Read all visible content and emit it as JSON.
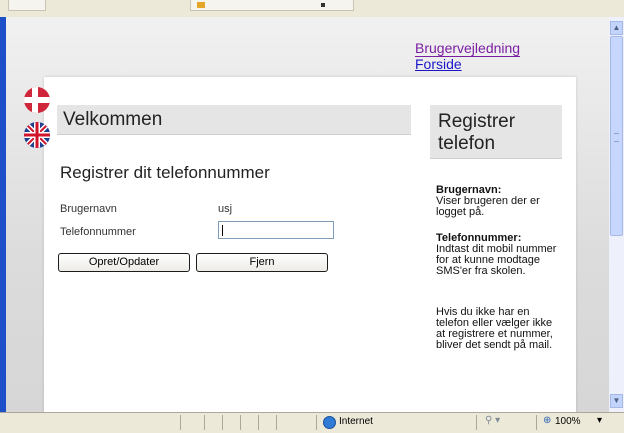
{
  "nav": {
    "user_guide": "Brugervejledning",
    "home": "Forside"
  },
  "languages": [
    "Dansk",
    "English"
  ],
  "main": {
    "title": "Velkommen",
    "subtitle": "Registrer dit telefonnummer",
    "username_label": "Brugernavn",
    "username_value": "usj",
    "phone_label": "Telefonnummer",
    "phone_value": "",
    "save_button": "Opret/Opdater",
    "remove_button": "Fjern"
  },
  "sidebar": {
    "title_line1": "Registrer",
    "title_line2": "telefon",
    "help_username_title": "Brugernavn:",
    "help_username_text": "Viser brugeren der er logget på.",
    "help_phone_title": "Telefonnummer:",
    "help_phone_text": "Indtast dit mobil nummer for at kunne modtage SMS'er fra skolen.",
    "help_note": "Hvis du ikke har en telefon eller vælger ikke at registrere et nummer, bliver det sendt på mail."
  },
  "status": {
    "zone": "Internet",
    "zoom": "100%"
  },
  "colors": {
    "link_visited": "#7b1fa2",
    "link": "#1a17c9",
    "flag_dk": "#d0263b",
    "flag_uk": "#1f3f8f"
  }
}
